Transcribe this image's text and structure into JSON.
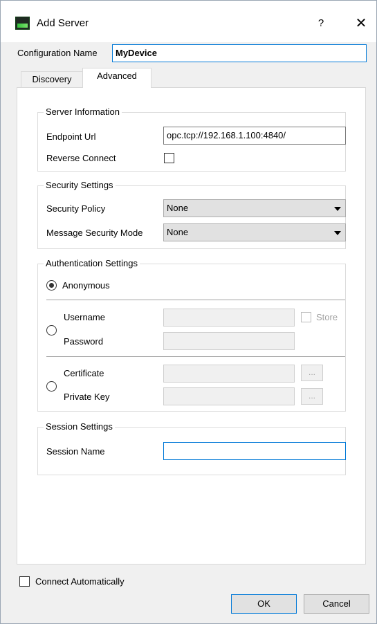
{
  "window": {
    "title": "Add Server",
    "help_label": "?",
    "close_label": "✕"
  },
  "config": {
    "label": "Configuration Name",
    "value": "MyDevice"
  },
  "tabs": [
    {
      "label": "Discovery"
    },
    {
      "label": "Advanced"
    }
  ],
  "server_info": {
    "title": "Server Information",
    "endpoint_label": "Endpoint Url",
    "endpoint_value": "opc.tcp://192.168.1.100:4840/",
    "reverse_label": "Reverse Connect",
    "reverse_checked": false
  },
  "security": {
    "title": "Security Settings",
    "policy_label": "Security Policy",
    "policy_value": "None",
    "mode_label": "Message Security Mode",
    "mode_value": "None"
  },
  "auth": {
    "title": "Authentication Settings",
    "anonymous_label": "Anonymous",
    "username_label": "Username",
    "store_label": "Store",
    "password_label": "Password",
    "certificate_label": "Certificate",
    "private_key_label": "Private Key",
    "browse_label": "..."
  },
  "session": {
    "title": "Session Settings",
    "name_label": "Session Name",
    "name_value": ""
  },
  "footer": {
    "connect_auto_label": "Connect Automatically",
    "ok_label": "OK",
    "cancel_label": "Cancel"
  },
  "icons": {
    "app": "opc-app-icon",
    "close": "close-icon",
    "help": "help-icon",
    "dropdown": "chevron-down-icon"
  }
}
